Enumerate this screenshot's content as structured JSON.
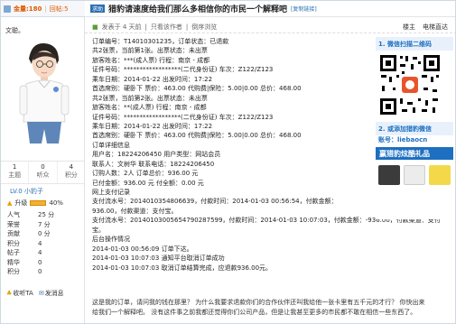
{
  "topbar": {
    "score_label": "金量:180",
    "sub_label": "回帖:5"
  },
  "user": {
    "name": "文聪。",
    "stats": [
      {
        "num": "1",
        "cap": "主题"
      },
      {
        "num": "0",
        "cap": "听众"
      },
      {
        "num": "4",
        "cap": "积分"
      }
    ],
    "level": "LV.0 小豹子",
    "upgrade_label": "升级",
    "upgrade_pct": "40%",
    "info": [
      {
        "k": "人气",
        "v": "25 分"
      },
      {
        "k": "荣誉",
        "v": "7 分"
      },
      {
        "k": "贡献",
        "v": "0 分"
      },
      {
        "k": "积分",
        "v": "4"
      },
      {
        "k": "帖子",
        "v": "4"
      },
      {
        "k": "精华",
        "v": "0"
      },
      {
        "k": "积分",
        "v": "0"
      }
    ],
    "actions": {
      "follow": "收听TA",
      "message": "发消息"
    }
  },
  "post": {
    "tag": "求助",
    "title": "猎豹请速度给我们那么多相信你的市民一个解释吧",
    "copy_link": "[复制链接]",
    "meta_prefix": "发表于 4 天前",
    "meta_only_author": "只看该作者",
    "meta_reverse": "倒序浏览",
    "floor": "楼主",
    "view_mode": "电梯直达"
  },
  "body_lines": [
    "订单编号：T14010301235，订单状态：已退款",
    "共2张票，当前第1张。出票状态：未出票",
    "旅客姓名：***(成人票)       行程：南京 - 成都",
    "证件号码：******************(二代身份证)          车次：Z122/Z123",
    "乘车日期：2014-01-22              出发时间：17:22",
    "   首选席别：硬卧下        票价：463.00         代购费|保险：5.00|0.00      总价：468.00",
    "共2张票，当前第2张。出票状态：未出票",
    "旅客姓名：**(成人票)        行程：南京 - 成都",
    "证件号码：******************(二代身份证)          车次：Z122/Z123",
    "乘车日期：2014-01-22              出发时间：17:22",
    "   首选席别：硬卧下        票价：463.00         代购费|保险：5.00|0.00      总价：468.00",
    "订单详细信息",
    "用户名：18224206450        用户类型：网站会员",
    "联系人：文树华             联系电话：18224206450",
    "订购人数：2人              订单总价：936.00 元",
    "已付金额：936.00 元        付全额：0.00 元",
    "网上支付记录",
    "支付流水号：2014010354806639，付款时间：2014-01-03 00:56:54，付款金额：",
    "936.00，付款渠道：支付宝。",
    "支付流水号：20140103005654790287599，付款时间：2014-01-03 10:07:03，付款金额：-936.00，付款渠道：支付",
    "宝。",
    "后台操作情况",
    "2014-01-03 00:56:09 订单下达。",
    "2014-01-03 10:07:03 通知平台取消订单成功",
    "2014-01-03 10:07:03 取消订单结算完成，应退款936.00元。"
  ],
  "footer_lines": [
    "这是我的订单，请问我的钱在那里？  为什么我要求退款你们的合作伙伴还叫我给他一张卡里有五千元的才行？  你快出来",
    "给我们一个解释吧。  没有这件事之前我都还觉得你们公司产品，但是让我甚至更多的市民都不敢在相信一些东西了。"
  ],
  "ad": {
    "step1": "1. 微信扫描二维码",
    "step2": "2. 或添加猎豹微信",
    "account": "账号：liebaocn",
    "brand": "赢猎豹炫酷礼品"
  }
}
